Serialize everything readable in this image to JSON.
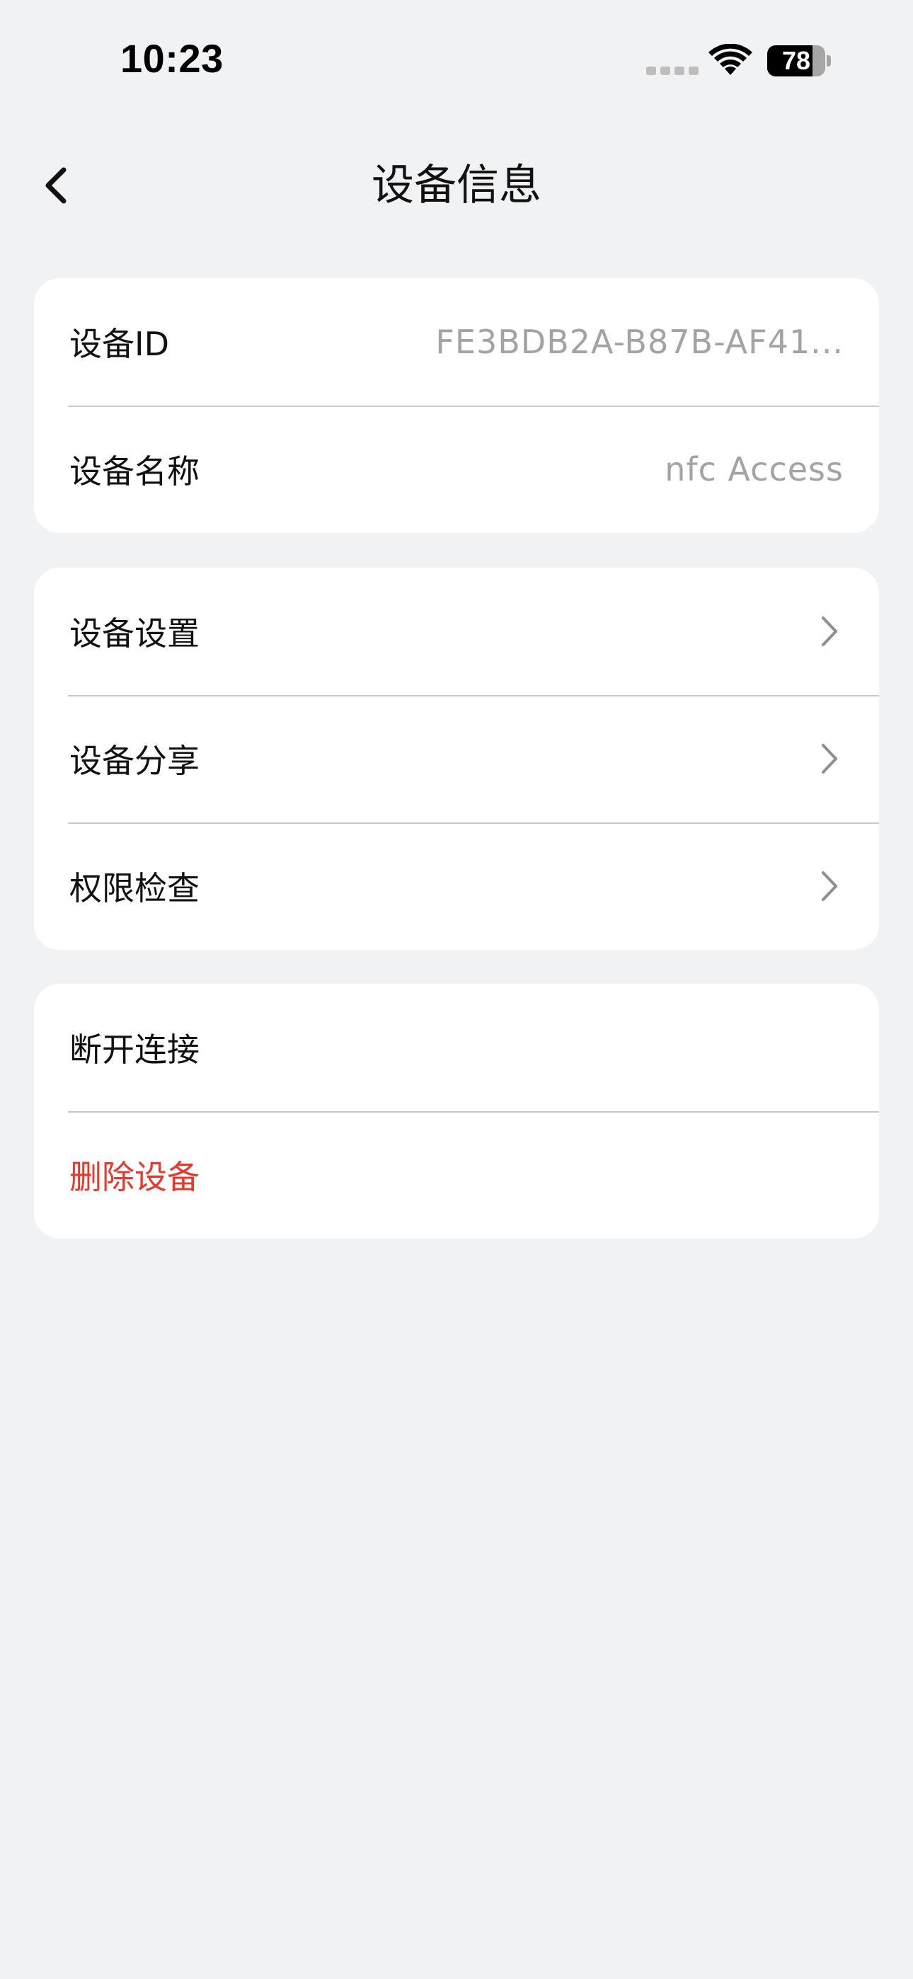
{
  "status_bar": {
    "time": "10:23",
    "battery_level": "78",
    "battery_fraction": 0.78,
    "icons": [
      "cellular-signal-icon",
      "wifi-icon",
      "battery-icon"
    ]
  },
  "nav": {
    "back_icon": "chevron-left-icon",
    "title": "设备信息"
  },
  "info_card": {
    "rows": [
      {
        "label": "设备ID",
        "value": "FE3BDB2A-B87B-AF41..."
      },
      {
        "label": "设备名称",
        "value": "nfc Access"
      }
    ]
  },
  "settings_card": {
    "rows": [
      {
        "label": "设备设置",
        "icon": "chevron-right-icon"
      },
      {
        "label": "设备分享",
        "icon": "chevron-right-icon"
      },
      {
        "label": "权限检查",
        "icon": "chevron-right-icon"
      }
    ]
  },
  "actions_card": {
    "rows": [
      {
        "label": "断开连接"
      },
      {
        "label": "删除设备",
        "color": "#e8382c"
      }
    ]
  },
  "colors": {
    "background": "#f1f2f4",
    "card": "#ffffff",
    "danger": "#e8382c",
    "secondary_text": "#a3a3a3"
  }
}
